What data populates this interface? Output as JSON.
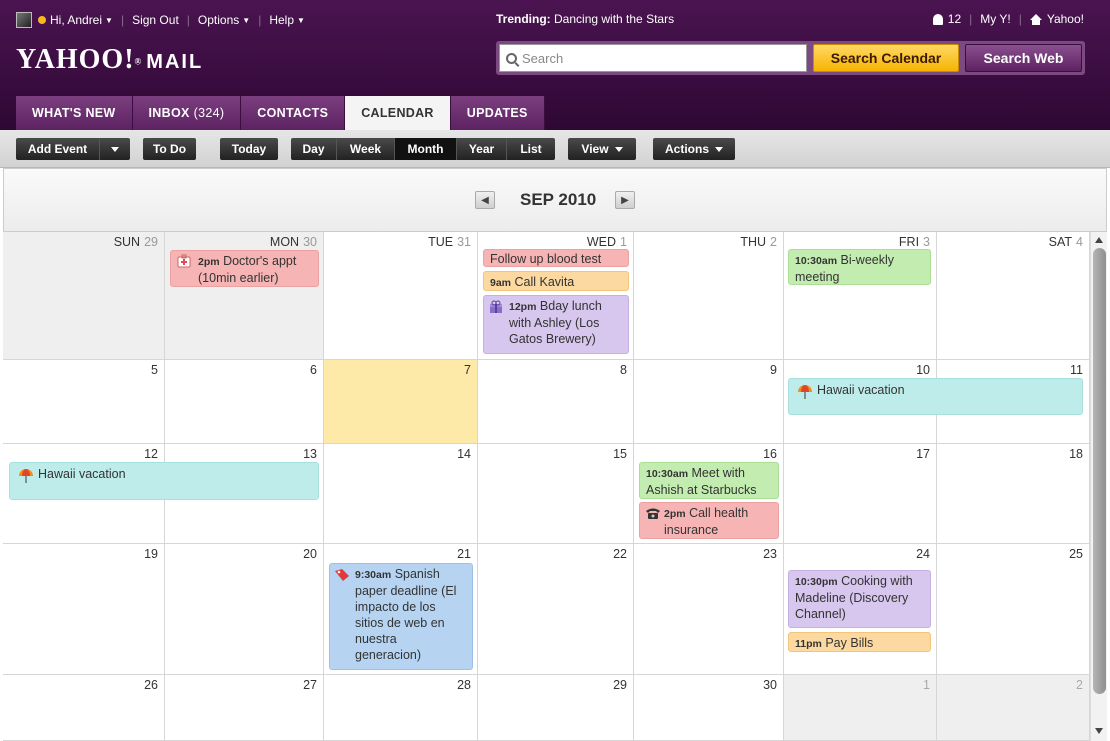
{
  "topbar": {
    "greeting": "Hi, Andrei",
    "sign_out": "Sign Out",
    "options": "Options",
    "help": "Help",
    "trending_label": "Trending:",
    "trending_value": "Dancing with the Stars",
    "notifications": "12",
    "my_y": "My Y!",
    "yahoo": "Yahoo!"
  },
  "logo": {
    "brand": "YAHOO!",
    "product": "MAIL"
  },
  "search": {
    "placeholder": "Search",
    "calendar_button": "Search Calendar",
    "web_button": "Search Web"
  },
  "tabs": {
    "whats_new": "WHAT'S NEW",
    "inbox": "INBOX",
    "inbox_count": "(324)",
    "contacts": "CONTACTS",
    "calendar": "CALENDAR",
    "updates": "UPDATES"
  },
  "toolbar": {
    "add_event": "Add Event",
    "todo": "To Do",
    "today": "Today",
    "day": "Day",
    "week": "Week",
    "month": "Month",
    "year": "Year",
    "list": "List",
    "view": "View",
    "actions": "Actions",
    "selected_view": "Month"
  },
  "calendar": {
    "month_title": "SEP 2010",
    "weekdays": [
      "SUN",
      "MON",
      "TUE",
      "WED",
      "THU",
      "FRI",
      "SAT"
    ],
    "week1_dates": [
      "29",
      "30",
      "31",
      "1",
      "2",
      "3",
      "4"
    ],
    "week2_dates": [
      "5",
      "6",
      "7",
      "8",
      "9",
      "10",
      "11"
    ],
    "week3_dates": [
      "12",
      "13",
      "14",
      "15",
      "16",
      "17",
      "18"
    ],
    "week4_dates": [
      "19",
      "20",
      "21",
      "22",
      "23",
      "24",
      "25"
    ],
    "week5_dates": [
      "26",
      "27",
      "28",
      "29",
      "30",
      "1",
      "2"
    ]
  },
  "events": {
    "doctor": {
      "time": "2pm",
      "title": "Doctor's appt (10min earlier)"
    },
    "blood_test": {
      "title": "Follow up blood test"
    },
    "kavita": {
      "time": "9am",
      "title": "Call Kavita"
    },
    "bday": {
      "time": "12pm",
      "title": "Bday lunch with Ashley (Los Gatos Brewery)"
    },
    "biweekly": {
      "time": "10:30am",
      "title": "Bi-weekly meeting"
    },
    "hawaii1": {
      "title": "Hawaii vacation"
    },
    "hawaii2": {
      "title": "Hawaii vacation"
    },
    "ashish": {
      "time": "10:30am",
      "title": "Meet with Ashish at Starbucks"
    },
    "health": {
      "time": "2pm",
      "title": "Call health insurance"
    },
    "spanish": {
      "time": "9:30am",
      "title": "Spanish paper deadline (El impacto de los sitios de web en nuestra generacion)"
    },
    "cooking": {
      "time": "10:30pm",
      "title": "Cooking with Madeline (Discovery Channel)"
    },
    "bills": {
      "time": "11pm",
      "title": "Pay Bills"
    }
  }
}
